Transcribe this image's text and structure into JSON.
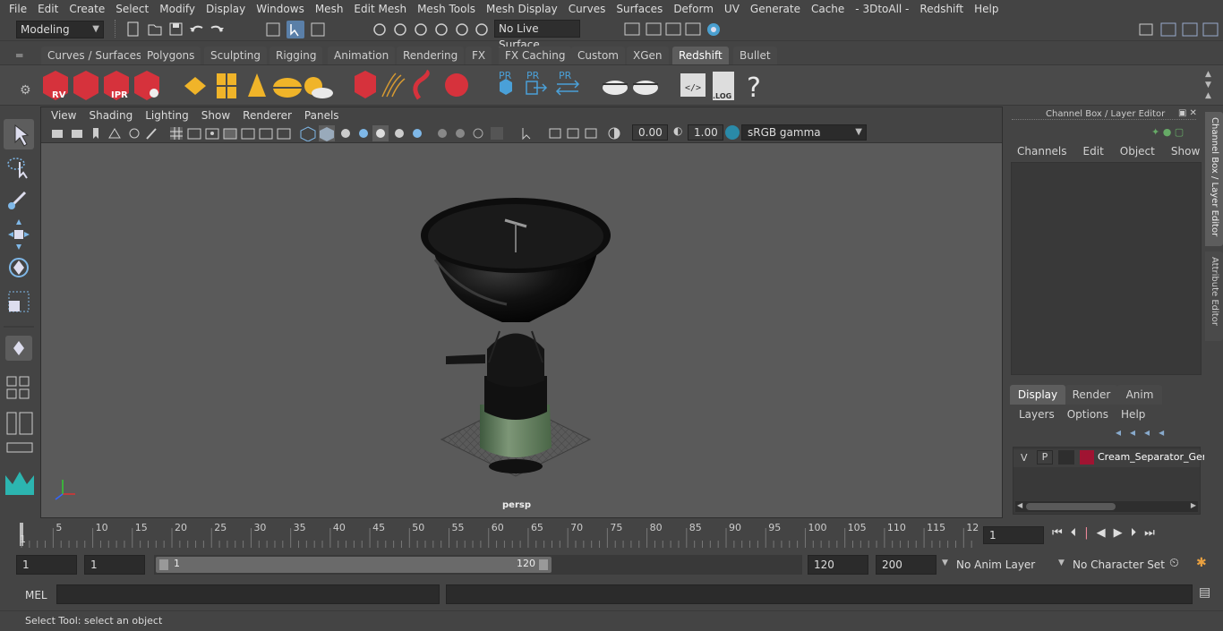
{
  "menubar": {
    "items": [
      "File",
      "Edit",
      "Create",
      "Select",
      "Modify",
      "Display",
      "Windows",
      "Mesh",
      "Edit Mesh",
      "Mesh Tools",
      "Mesh Display",
      "Curves",
      "Surfaces",
      "Deform",
      "UV",
      "Generate",
      "Cache",
      "- 3DtoAll -",
      "Redshift",
      "Help"
    ]
  },
  "statusline": {
    "mode": "Modeling",
    "live_surface": "No Live Surface"
  },
  "shelf": {
    "tabs": [
      "Curves / Surfaces",
      "Polygons",
      "Sculpting",
      "Rigging",
      "Animation",
      "Rendering",
      "FX",
      "FX Caching",
      "Custom",
      "XGen",
      "Redshift",
      "Bullet"
    ],
    "active_tab": "Redshift",
    "icon_labels": {
      "rv": "RV",
      "ipr": "IPR",
      "pr1": "PR",
      "pr2": "PR",
      "pr3": "PR",
      "log": ".LOG",
      "help": "?"
    }
  },
  "viewport": {
    "menu": [
      "View",
      "Shading",
      "Lighting",
      "Show",
      "Renderer",
      "Panels"
    ],
    "exposure": "0.00",
    "gamma": "1.00",
    "colorspace": "sRGB gamma",
    "camera_label": "persp"
  },
  "channelbox": {
    "title": "Channel Box / Layer Editor",
    "menu": [
      "Channels",
      "Edit",
      "Object",
      "Show"
    ],
    "layer_tabs": [
      "Display",
      "Render",
      "Anim"
    ],
    "active_layer_tab": "Display",
    "layer_menu": [
      "Layers",
      "Options",
      "Help"
    ],
    "layer": {
      "v": "V",
      "p": "P",
      "name": "Cream_Separator_Gen",
      "color": "#a01432"
    }
  },
  "sidetabs": {
    "channel": "Channel Box / Layer Editor",
    "attribute": "Attribute Editor"
  },
  "timeline": {
    "ticks": [
      "5",
      "10",
      "15",
      "20",
      "25",
      "30",
      "35",
      "40",
      "45",
      "50",
      "55",
      "60",
      "65",
      "70",
      "75",
      "80",
      "85",
      "90",
      "95",
      "100",
      "105",
      "110",
      "115",
      "12"
    ],
    "start_label": "1",
    "current_frame": "1"
  },
  "rangebar": {
    "start": "1",
    "playback_start": "1",
    "slider_start": "1",
    "slider_end": "120",
    "playback_end": "120",
    "end": "200",
    "anim_layer": "No Anim Layer",
    "character_set": "No Character Set"
  },
  "cmdline": {
    "label": "MEL"
  },
  "helpline": {
    "text": "Select Tool: select an object"
  },
  "colors": {
    "accent": "#5aa0d8",
    "redshift_red": "#d6323c",
    "model_green": "#5e7a5a"
  }
}
